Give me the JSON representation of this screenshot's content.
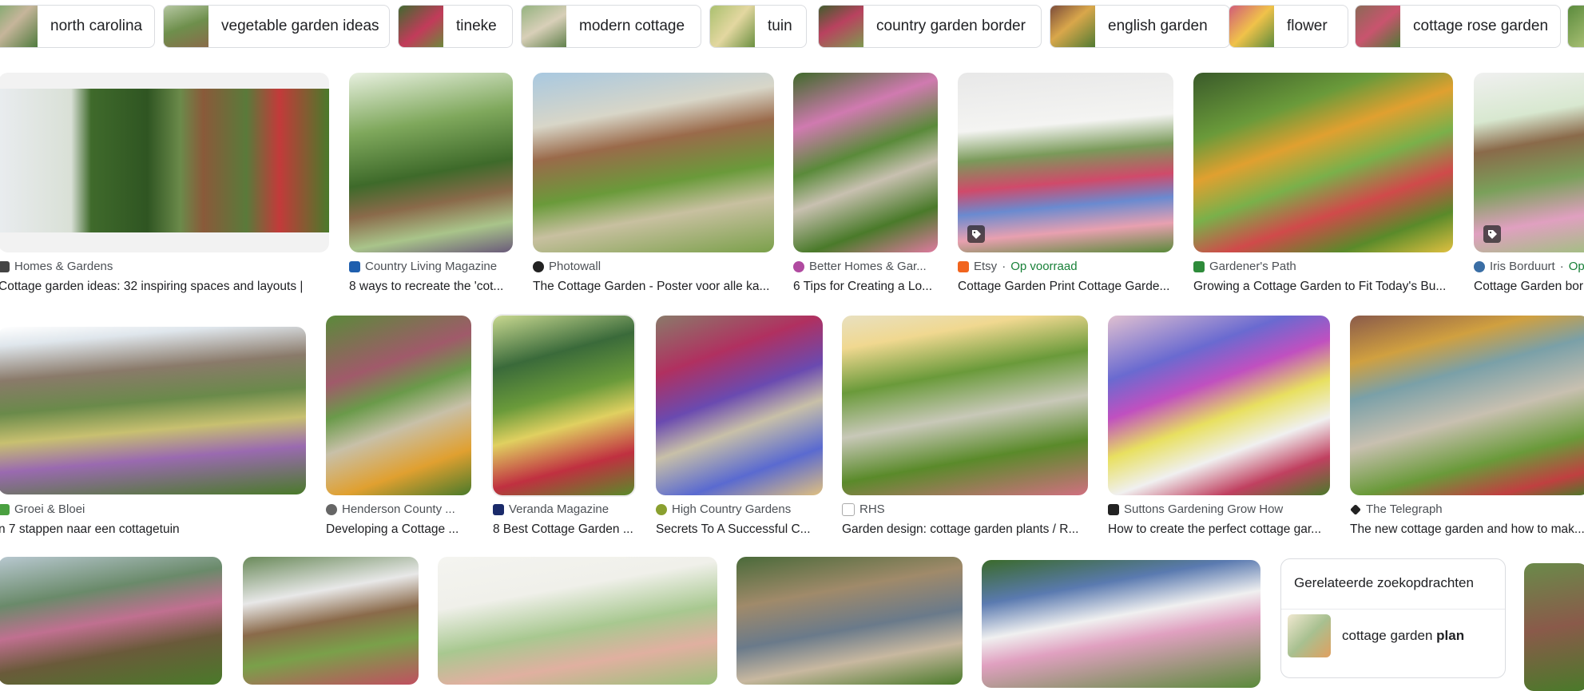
{
  "chips": [
    {
      "label": "north carolina"
    },
    {
      "label": "vegetable garden ideas"
    },
    {
      "label": "tineke"
    },
    {
      "label": "modern cottage"
    },
    {
      "label": "tuin"
    },
    {
      "label": "country garden border"
    },
    {
      "label": "english garden"
    },
    {
      "label": "flower"
    },
    {
      "label": "cottage rose garden"
    }
  ],
  "results": [
    {
      "source": "Homes & Gardens",
      "title": "Cottage garden ideas: 32 inspiring spaces and layouts |"
    },
    {
      "source": "Country Living Magazine",
      "title": "8 ways to recreate the 'cot..."
    },
    {
      "source": "Photowall",
      "title": "The Cottage Garden - Poster voor alle ka..."
    },
    {
      "source": "Better Homes & Gar...",
      "title": "6 Tips for Creating a Lo..."
    },
    {
      "source": "Etsy",
      "source_extra": "Op voorraad",
      "title": "Cottage Garden Print Cottage Garde..."
    },
    {
      "source": "Gardener's Path",
      "title": "Growing a Cottage Garden to Fit Today's Bu..."
    },
    {
      "source": "Iris Borduurt",
      "source_extra": "Op",
      "title": "Cottage Garden bor"
    },
    {
      "source": "Groei & Bloei",
      "title": "n 7 stappen naar een cottagetuin"
    },
    {
      "source": "Henderson County ...",
      "title": "Developing a Cottage ..."
    },
    {
      "source": "Veranda Magazine",
      "title": "8 Best Cottage Garden ..."
    },
    {
      "source": "High Country Gardens",
      "title": "Secrets To A Successful C..."
    },
    {
      "source": "RHS",
      "title": "Garden design: cottage garden plants / R..."
    },
    {
      "source": "Suttons Gardening Grow How",
      "title": "How to create the perfect cottage gar..."
    },
    {
      "source": "The Telegraph",
      "title": "The new cottage garden and how to mak..."
    }
  ],
  "related": {
    "heading": "Gerelateerde zoekopdrachten",
    "item_prefix": "cottage garden",
    "item_bold": "plan"
  },
  "colors": {
    "in_stock_green": "#188038",
    "border": "#dadce0",
    "text": "#202124",
    "source_text": "#4d5156"
  }
}
